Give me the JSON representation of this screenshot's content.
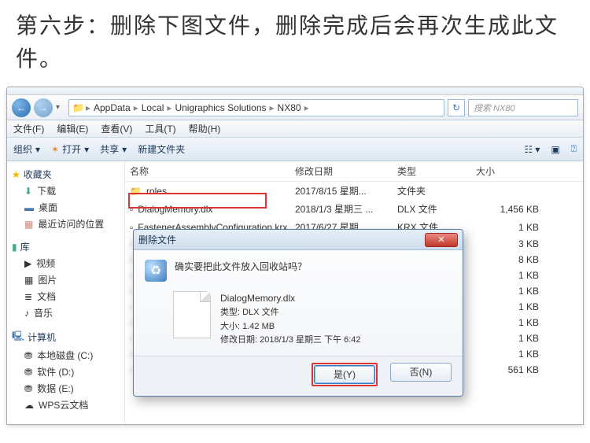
{
  "caption": "第六步：删除下图文件，删除完成后会再次生成此文件。",
  "breadcrumb": [
    "AppData",
    "Local",
    "Unigraphics Solutions",
    "NX80"
  ],
  "search_placeholder": "搜索 NX80",
  "menubar": [
    "文件(F)",
    "编辑(E)",
    "查看(V)",
    "工具(T)",
    "帮助(H)"
  ],
  "toolbar": {
    "organize": "组织",
    "open": "打开",
    "share": "共享",
    "newfolder": "新建文件夹"
  },
  "sidebar": {
    "fav": {
      "title": "收藏夹",
      "items": [
        "下载",
        "桌面",
        "最近访问的位置"
      ]
    },
    "lib": {
      "title": "库",
      "items": [
        "视频",
        "图片",
        "文档",
        "音乐"
      ]
    },
    "comp": {
      "title": "计算机",
      "items": [
        "本地磁盘 (C:)",
        "软件 (D:)",
        "数据 (E:)",
        "WPS云文档"
      ]
    }
  },
  "columns": {
    "name": "名称",
    "date": "修改日期",
    "type": "类型",
    "size": "大小"
  },
  "files": [
    {
      "name": "roles",
      "date": "2017/8/15 星期...",
      "type": "文件夹",
      "size": ""
    },
    {
      "name": "DialogMemory.dlx",
      "date": "2018/1/3 星期三 ...",
      "type": "DLX 文件",
      "size": "1,456 KB"
    },
    {
      "name": "FastenerAssemblyConfiguration.krx",
      "date": "2017/6/27 星期...",
      "type": "KRX 文件",
      "size": "1 KB"
    },
    {
      "name": "",
      "date": "",
      "type": "",
      "size": "3 KB"
    },
    {
      "name": "",
      "date": "",
      "type": "",
      "size": "8 KB"
    },
    {
      "name": "",
      "date": "",
      "type": "",
      "size": "1 KB"
    },
    {
      "name": "",
      "date": "",
      "type": "",
      "size": "1 KB"
    },
    {
      "name": "",
      "date": "",
      "type": "",
      "size": "1 KB"
    },
    {
      "name": "",
      "date": "",
      "type": "",
      "size": "1 KB"
    },
    {
      "name": "",
      "date": "",
      "type": "",
      "size": "1 KB"
    },
    {
      "name": "",
      "date": "",
      "type": "",
      "size": "1 KB"
    },
    {
      "name": "",
      "date": "",
      "type": "",
      "size": "561 KB"
    }
  ],
  "dialog": {
    "title": "删除文件",
    "message": "确实要把此文件放入回收站吗？",
    "filename": "DialogMemory.dlx",
    "ftype": "类型: DLX 文件",
    "fsize": "大小: 1.42 MB",
    "fdate": "修改日期: 2018/1/3 星期三 下午 6:42",
    "yes": "是(Y)",
    "no": "否(N)"
  }
}
